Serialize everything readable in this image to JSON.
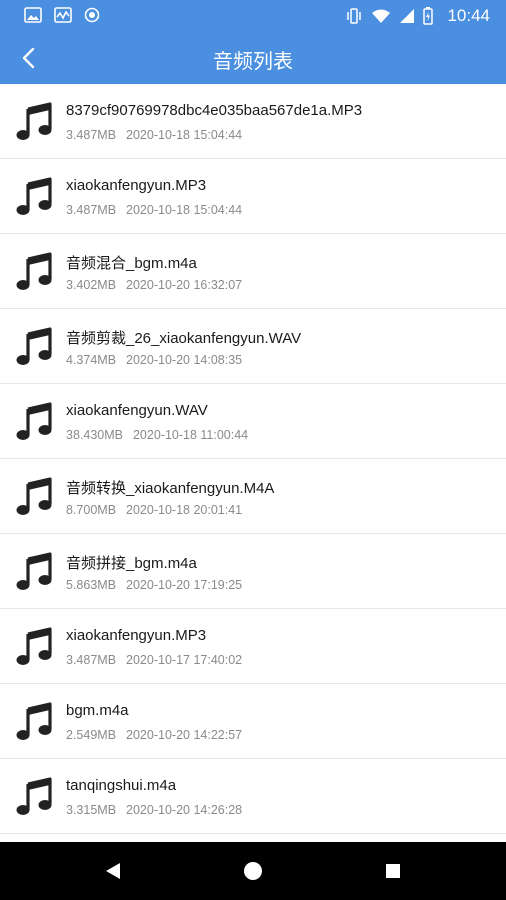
{
  "status_bar": {
    "time": "10:44"
  },
  "app_bar": {
    "title": "音频列表"
  },
  "files": [
    {
      "name": "8379cf90769978dbc4e035baa567de1a.MP3",
      "size": "3.487MB",
      "date": "2020-10-18 15:04:44"
    },
    {
      "name": "xiaokanfengyun.MP3",
      "size": "3.487MB",
      "date": "2020-10-18 15:04:44"
    },
    {
      "name": "音频混合_bgm.m4a",
      "size": "3.402MB",
      "date": "2020-10-20 16:32:07"
    },
    {
      "name": "音频剪裁_26_xiaokanfengyun.WAV",
      "size": "4.374MB",
      "date": "2020-10-20 14:08:35"
    },
    {
      "name": "xiaokanfengyun.WAV",
      "size": "38.430MB",
      "date": "2020-10-18 11:00:44"
    },
    {
      "name": "音频转换_xiaokanfengyun.M4A",
      "size": "8.700MB",
      "date": "2020-10-18 20:01:41"
    },
    {
      "name": "音频拼接_bgm.m4a",
      "size": "5.863MB",
      "date": "2020-10-20 17:19:25"
    },
    {
      "name": "xiaokanfengyun.MP3",
      "size": "3.487MB",
      "date": "2020-10-17 17:40:02"
    },
    {
      "name": "bgm.m4a",
      "size": "2.549MB",
      "date": "2020-10-20 14:22:57"
    },
    {
      "name": "tanqingshui.m4a",
      "size": "3.315MB",
      "date": "2020-10-20 14:26:28"
    }
  ],
  "colors": {
    "primary": "#4a8fe0",
    "navbar": "#000000"
  },
  "icons": {
    "file": "music-note-icon",
    "back": "back-arrow-icon"
  }
}
